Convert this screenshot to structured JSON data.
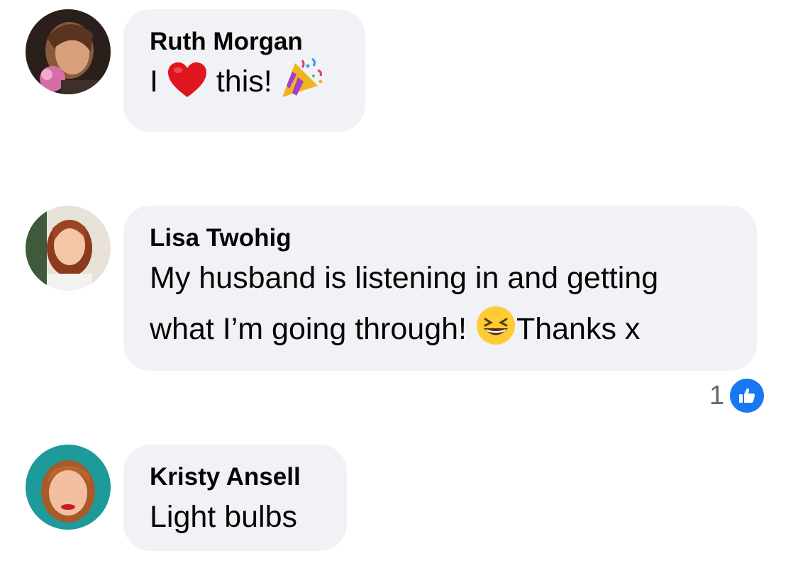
{
  "comments": [
    {
      "author": "Ruth Morgan",
      "text_parts": [
        "I",
        "this!"
      ],
      "emojis": [
        "red-heart-emoji",
        "party-popper-emoji"
      ]
    },
    {
      "author": "Lisa Twohig",
      "line1": "My husband is listening in and getting",
      "line2_a": "what I’m going through!",
      "line2_b": "Thanks x",
      "emojis": [
        "grinning-squinting-face-emoji"
      ],
      "reactions": {
        "count": "1",
        "type": "like",
        "color": "#1877f2"
      }
    },
    {
      "author": "Kristy Ansell",
      "text": "Light bulbs"
    }
  ],
  "colors": {
    "bubble_bg": "#f0f2f5",
    "text": "#050505",
    "secondary_text": "#65676b",
    "like_blue": "#1877f2"
  }
}
